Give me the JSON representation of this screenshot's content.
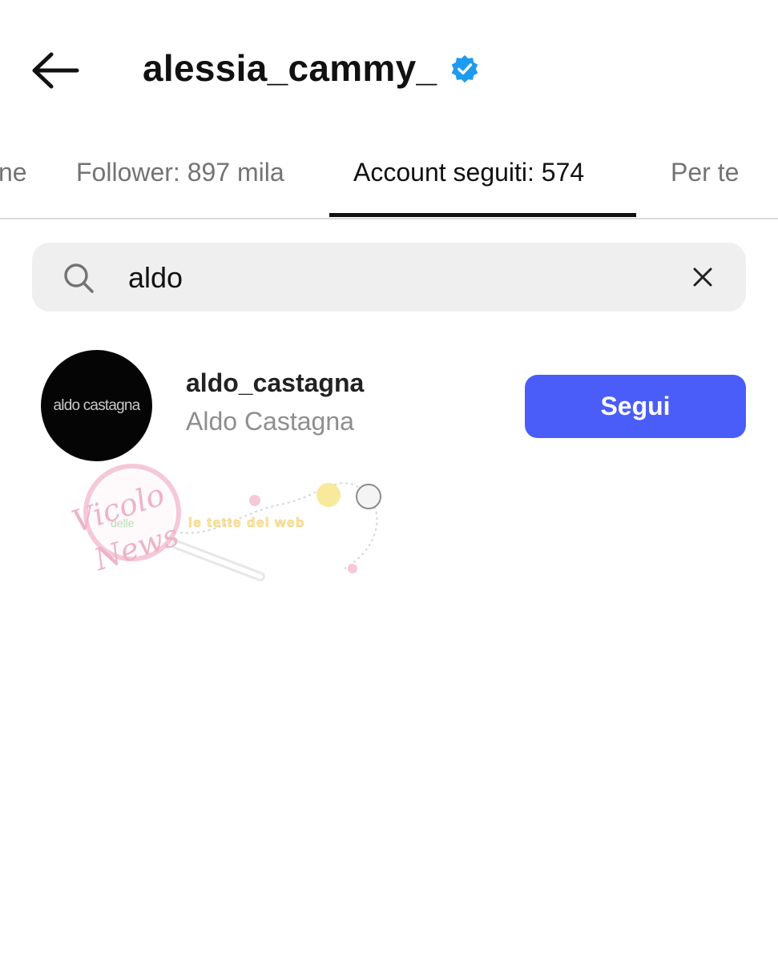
{
  "header": {
    "title": "alessia_cammy_",
    "verified_icon": "verified-badge-icon",
    "back_icon": "arrow-left-icon"
  },
  "tabs": [
    {
      "label": "ne",
      "active": false
    },
    {
      "label": "Follower: 897 mila",
      "active": false
    },
    {
      "label": "Account seguiti: 574",
      "active": true
    },
    {
      "label": "Per te",
      "active": false
    }
  ],
  "search": {
    "value": "aldo",
    "icon": "search-icon",
    "clear_icon": "close-icon"
  },
  "results": [
    {
      "username": "aldo_castagna",
      "full_name": "Aldo Castagna",
      "avatar_text": "aldo castagna",
      "button_label": "Segui"
    }
  ],
  "watermark": {
    "line1": "Vicolo",
    "line2": "delle",
    "line3": "News",
    "tagline": "le tette del web"
  },
  "colors": {
    "accent": "#4a5df9",
    "verified": "#1d9bf0",
    "tab_active": "#111111",
    "tab_inactive": "#737373",
    "search_bg": "#efefef"
  }
}
